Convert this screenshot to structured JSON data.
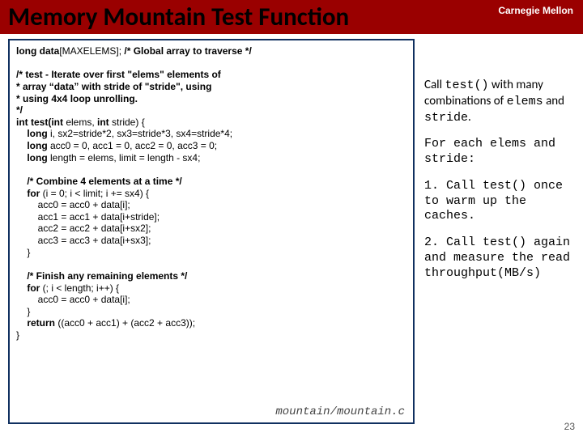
{
  "header": {
    "brand": "Carnegie Mellon",
    "title": "Memory Mountain Test Function"
  },
  "code": {
    "line01a": "long data",
    "line01b": "[MAXELEMS];  ",
    "line01c": "/* Global array to traverse */",
    "line03a": "/* test - Iterate over first \"elems\" elements of",
    "line04a": " *        array “data” with stride of \"stride\", using",
    "line05a": " *        using 4x4 loop unrolling.",
    "line06a": " */",
    "line07a": "int test(int ",
    "line07b": "elems, ",
    "line07c": "int ",
    "line07d": "stride) {",
    "line08a": "    long ",
    "line08b": "i, sx2=stride*2, sx3=stride*3, sx4=stride*4;",
    "line09a": "    long ",
    "line09b": "acc0 = 0, acc1 = 0, acc2 = 0, acc3 = 0;",
    "line10a": "    long ",
    "line10b": "length = elems, limit = length - sx4;",
    "line12a": "    /* Combine 4 elements at a time */",
    "line13a": "    for ",
    "line13b": "(i = 0; i < limit; i += sx4) {",
    "line14a": "        acc0 = acc0 + data[i];",
    "line15a": "        acc1 = acc1 + data[i+stride];",
    "line16a": "        acc2 = acc2 + data[i+sx2];",
    "line17a": "        acc3 = acc3 + data[i+sx3];",
    "line18a": "    }",
    "line20a": "    /* Finish any remaining elements */",
    "line21a": "    for ",
    "line21b": "(; i < length; i++) {",
    "line22a": "        acc0 = acc0 + data[i];",
    "line23a": "    }",
    "line24a": "    return ",
    "line24b": "((acc0 + acc1) + (acc2 + acc3));",
    "line25a": "}",
    "file": "mountain/mountain.c"
  },
  "notes": {
    "p1a": "Call ",
    "p1b": "test()",
    "p1c": " with many combinations of ",
    "p1d": "elems",
    "p1e": " and ",
    "p1f": "stride",
    "p1g": ".",
    "p2a": "For each elems and stride:",
    "p3a": "1. Call ",
    "p3b": "test()",
    "p3c": " once to warm up the caches.",
    "p4a": "2. Call ",
    "p4b": "test()",
    "p4c": " again and measure the read throughput(MB/s)"
  },
  "pagenum": "23"
}
